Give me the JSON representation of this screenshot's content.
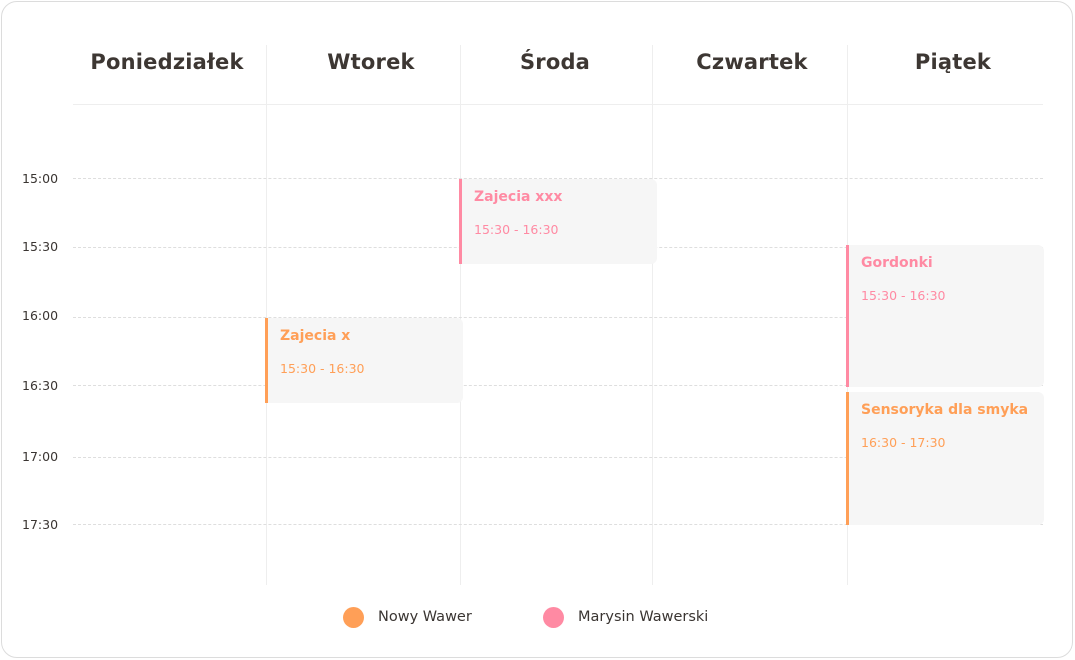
{
  "days": [
    "Poniedziałek",
    "Wtorek",
    "Środa",
    "Czwartek",
    "Piątek"
  ],
  "times": [
    "15:00",
    "15:30",
    "16:00",
    "16:30",
    "17:00",
    "17:30"
  ],
  "events": [
    {
      "title": "Zajecia xxx",
      "time": "15:30 - 16:30",
      "location": "Marysin Wawerski"
    },
    {
      "title": "Zajecia x",
      "time": "15:30 - 16:30",
      "location": "Nowy Wawer"
    },
    {
      "title": "Gordonki",
      "time": "15:30 - 16:30",
      "location": "Marysin Wawerski"
    },
    {
      "title": "Sensoryka dla smyka",
      "time": "16:30 - 17:30",
      "location": "Nowy Wawer"
    }
  ],
  "legend": [
    {
      "label": "Nowy Wawer",
      "color": "#ff9f57"
    },
    {
      "label": "Marysin Wawerski",
      "color": "#ff8aa3"
    }
  ],
  "colors": {
    "orange": "#ff9f57",
    "pink": "#ff8aa3"
  }
}
